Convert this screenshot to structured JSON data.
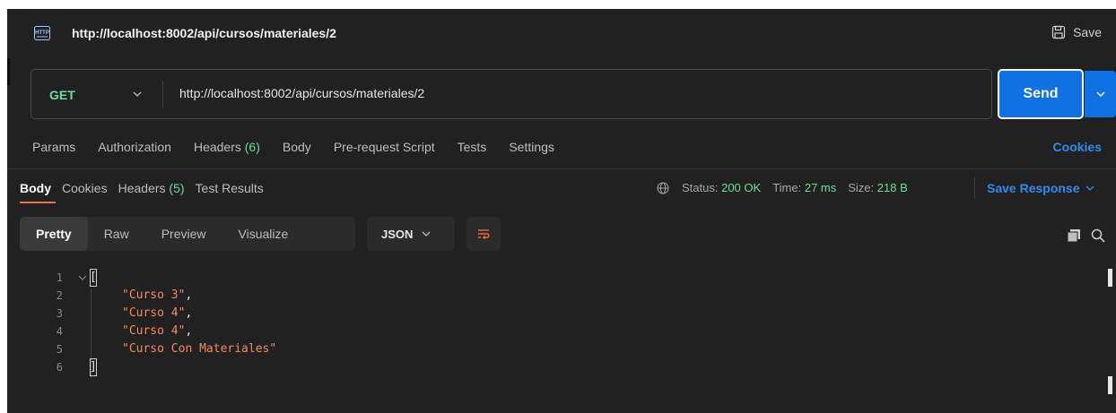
{
  "title_bar": {
    "icon": "http-icon",
    "url": "http://localhost:8002/api/cursos/materiales/2",
    "save_label": "Save"
  },
  "request": {
    "method": "GET",
    "url": "http://localhost:8002/api/cursos/materiales/2",
    "send_label": "Send"
  },
  "request_tabs": {
    "params": "Params",
    "authorization": "Authorization",
    "headers": "Headers",
    "headers_count": "(6)",
    "body": "Body",
    "pre_request": "Pre-request Script",
    "tests": "Tests",
    "settings": "Settings",
    "cookies": "Cookies"
  },
  "response_tabs": {
    "body": "Body",
    "cookies": "Cookies",
    "headers": "Headers",
    "headers_count": "(5)",
    "test_results": "Test Results"
  },
  "status": {
    "status_label": "Status:",
    "status_value": "200 OK",
    "time_label": "Time:",
    "time_value": "27 ms",
    "size_label": "Size:",
    "size_value": "218 B",
    "save_response": "Save Response"
  },
  "view_modes": {
    "pretty": "Pretty",
    "raw": "Raw",
    "preview": "Preview",
    "visualize": "Visualize",
    "format": "JSON"
  },
  "code": {
    "lines": [
      {
        "num": "1",
        "text": "["
      },
      {
        "num": "2",
        "text": "\"Curso 3\""
      },
      {
        "num": "3",
        "text": "\"Curso 4\""
      },
      {
        "num": "4",
        "text": "\"Curso 4\""
      },
      {
        "num": "5",
        "text": "\"Curso Con Materiales\""
      },
      {
        "num": "6",
        "text": "]"
      }
    ],
    "comma": ","
  },
  "colors": {
    "accent_blue": "#0e71e4",
    "link_blue": "#2e8cf0",
    "success_green": "#6bdd9a",
    "string_orange": "#f28b5a",
    "tab_underline": "#f26b3a"
  }
}
